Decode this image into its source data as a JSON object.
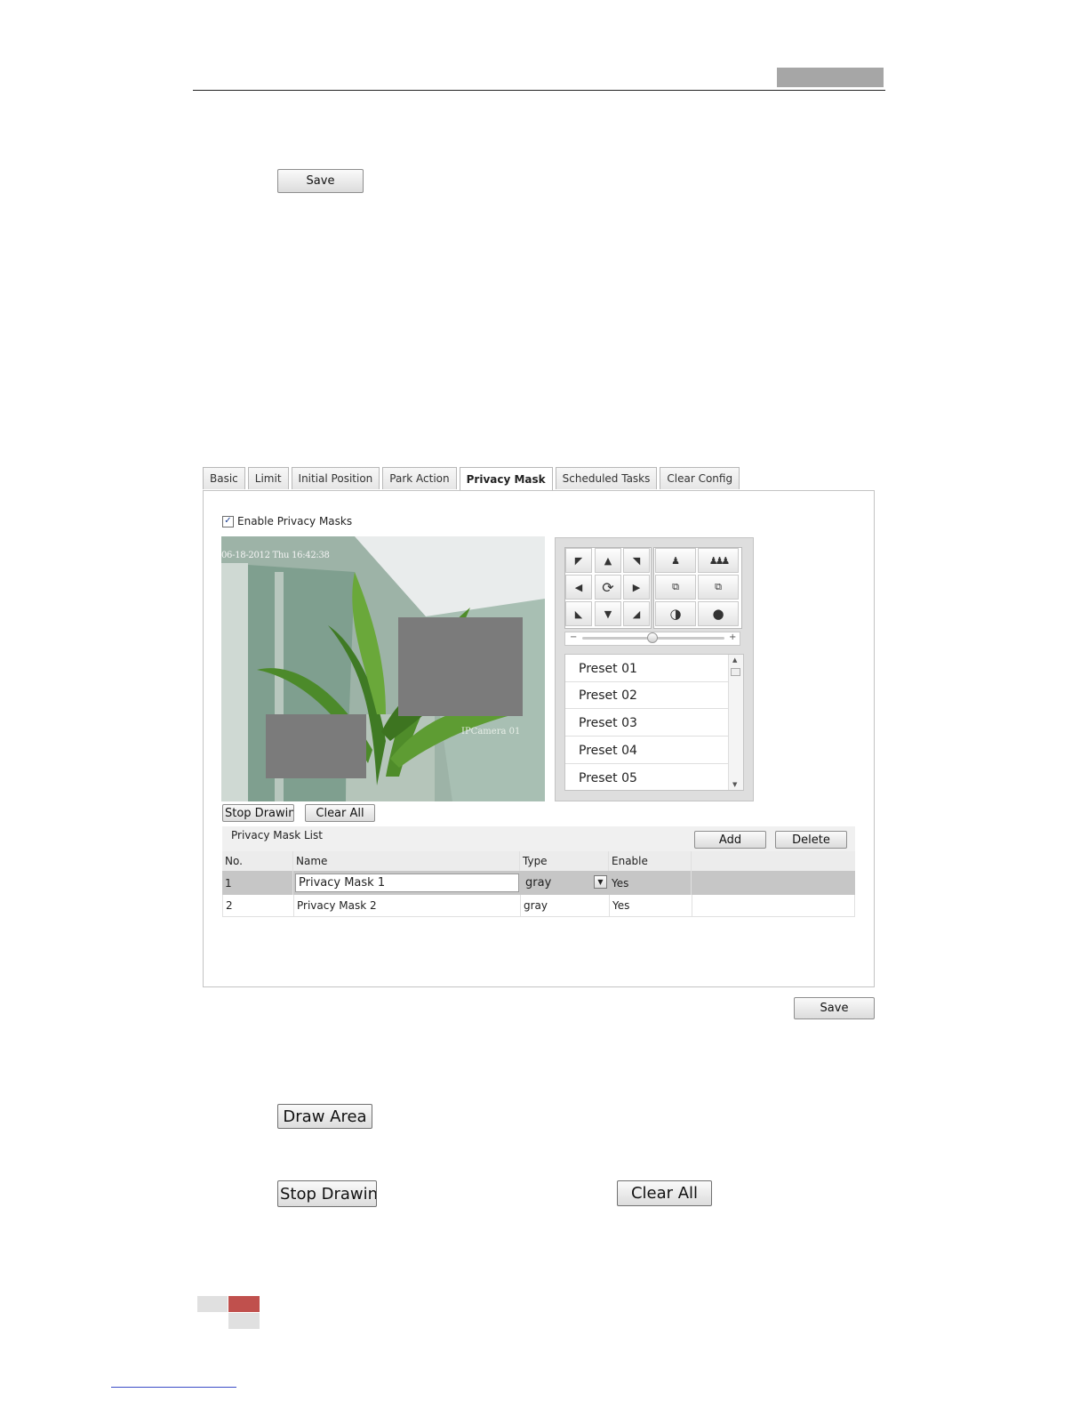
{
  "top_save": "Save",
  "tabs": [
    "Basic",
    "Limit",
    "Initial Position",
    "Park Action",
    "Privacy Mask",
    "Scheduled Tasks",
    "Clear Config"
  ],
  "active_tab": "Privacy Mask",
  "enable_label": "Enable Privacy Masks",
  "enable_checked": true,
  "video": {
    "timestamp": "06-18-2012 Thu 16:42:38",
    "camera_name": "IPCamera 01"
  },
  "ptz_icons": {
    "row1": [
      "arrow-up-left-icon",
      "arrow-up-icon",
      "arrow-up-right-icon",
      "zoom-in-icon",
      "zoom-out-icon"
    ],
    "row2": [
      "arrow-left-icon",
      "auto-pan-icon",
      "arrow-right-icon",
      "focus-near-icon",
      "focus-far-icon"
    ],
    "row3": [
      "arrow-down-left-icon",
      "arrow-down-icon",
      "arrow-down-right-icon",
      "iris-open-icon",
      "iris-close-icon"
    ]
  },
  "slider": {
    "minus": "−",
    "plus": "+",
    "level": 0.5
  },
  "presets": [
    "Preset 01",
    "Preset 02",
    "Preset 03",
    "Preset 04",
    "Preset 05"
  ],
  "draw_buttons": {
    "stop_drawing": "Stop Drawing",
    "clear_all": "Clear All"
  },
  "mask_list": {
    "title": "Privacy Mask List",
    "add": "Add",
    "delete": "Delete",
    "columns": [
      "No.",
      "Name",
      "Type",
      "Enable"
    ],
    "rows": [
      {
        "no": "1",
        "name": "Privacy Mask 1",
        "type": "gray",
        "enable": "Yes"
      },
      {
        "no": "2",
        "name": "Privacy Mask 2",
        "type": "gray",
        "enable": "Yes"
      }
    ]
  },
  "bottom_save": "Save",
  "standalone": {
    "draw_area": "Draw Area",
    "stop_drawing": "Stop Drawing",
    "clear_all": "Clear All"
  },
  "colors": {
    "mask_gray": "#7b7b7b",
    "selected_row": "#c6c6c6",
    "header_tag": "#a6a6a6",
    "footer_red": "#c0504d"
  }
}
